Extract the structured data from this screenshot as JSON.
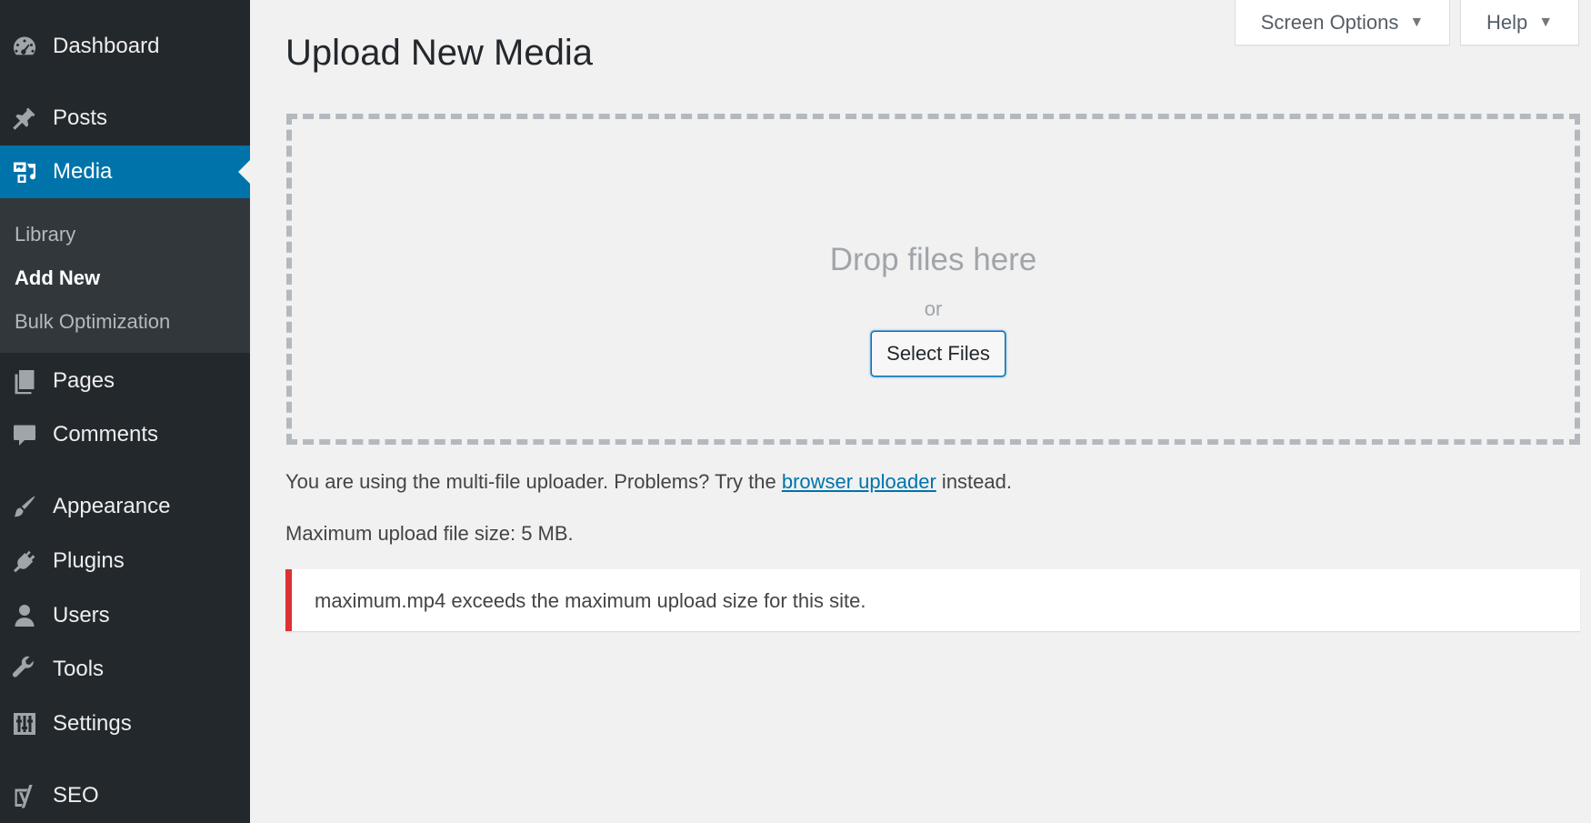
{
  "sidebar": {
    "menu": [
      {
        "label": "Dashboard",
        "icon": "dashboard-icon"
      },
      {
        "label": "Posts",
        "icon": "pushpin-icon"
      },
      {
        "label": "Media",
        "icon": "media-icon",
        "current": true
      },
      {
        "label": "Pages",
        "icon": "pages-icon"
      },
      {
        "label": "Comments",
        "icon": "comment-bubble-icon"
      },
      {
        "label": "Appearance",
        "icon": "paintbrush-icon"
      },
      {
        "label": "Plugins",
        "icon": "plug-icon"
      },
      {
        "label": "Users",
        "icon": "user-icon"
      },
      {
        "label": "Tools",
        "icon": "wrench-icon"
      },
      {
        "label": "Settings",
        "icon": "sliders-icon"
      },
      {
        "label": "SEO",
        "icon": "yoast-seo-icon"
      }
    ],
    "submenu": [
      {
        "label": "Library"
      },
      {
        "label": "Add New",
        "active": true
      },
      {
        "label": "Bulk Optimization"
      }
    ]
  },
  "header": {
    "screen_options": "Screen Options",
    "help": "Help"
  },
  "main": {
    "title": "Upload New Media",
    "drop_text": "Drop files here",
    "or_text": "or",
    "select_files": "Select Files",
    "uploader_text_before": "You are using the multi-file uploader. Problems? Try the ",
    "uploader_link": "browser uploader",
    "uploader_text_after": " instead.",
    "max_size": "Maximum upload file size: 5 MB.",
    "error": "maximum.mp4 exceeds the maximum upload size for this site."
  },
  "colors": {
    "sidebar_bg": "#23282d",
    "submenu_bg": "#32373c",
    "accent": "#0073aa",
    "error": "#dc3232",
    "page_bg": "#f1f1f1"
  }
}
